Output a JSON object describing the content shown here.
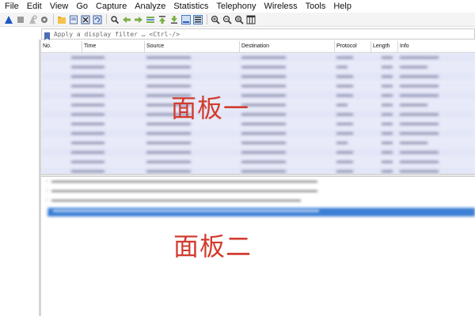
{
  "menu": [
    "File",
    "Edit",
    "View",
    "Go",
    "Capture",
    "Analyze",
    "Statistics",
    "Telephony",
    "Wireless",
    "Tools",
    "Help"
  ],
  "toolbar": {
    "icons": [
      "shark-fin-start-icon",
      "stop-square-icon",
      "restart-icon",
      "options-gear-icon",
      "open-folder-icon",
      "save-file-icon",
      "close-file-icon",
      "reload-icon",
      "find-icon",
      "back-arrow-icon",
      "forward-arrow-icon",
      "goto-packet-icon",
      "first-packet-icon",
      "last-packet-icon",
      "auto-scroll-icon",
      "colorize-icon",
      "zoom-in-icon",
      "zoom-out-icon",
      "zoom-normal-icon",
      "resize-columns-icon"
    ]
  },
  "filter": {
    "placeholder": "Apply a display filter … <Ctrl-/>"
  },
  "packet_list": {
    "columns": [
      "No.",
      "Time",
      "Source",
      "Destination",
      "Protocol",
      "Length",
      "Info"
    ],
    "overlay_label": "面板一"
  },
  "packet_details": {
    "overlay_label": "面板二"
  },
  "colors": {
    "row_bg": "#e3e6f7",
    "selected_bg": "#3c7fd4",
    "label_red": "#d23c2f"
  }
}
